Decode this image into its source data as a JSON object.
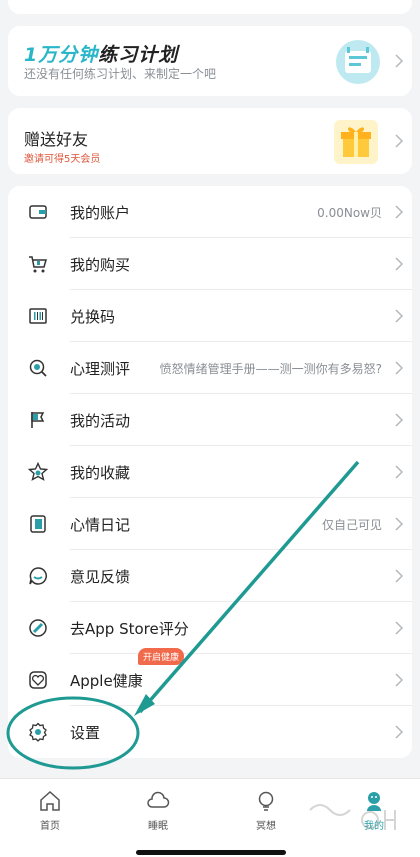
{
  "plan": {
    "title_highlight": "1万分钟",
    "title_rest": "练习计划",
    "subtitle": "还没有任何练习计划、来制定一个吧"
  },
  "gift": {
    "title": "赠送好友",
    "subtitle": "邀请可得5天会员"
  },
  "menu": [
    {
      "label": "我的账户",
      "right": "0.00Now贝",
      "icon": "wallet-icon"
    },
    {
      "label": "我的购买",
      "right": "",
      "icon": "cart-icon"
    },
    {
      "label": "兑换码",
      "right": "",
      "icon": "barcode-icon"
    },
    {
      "label": "心理测评",
      "right": "愤怒情绪管理手册——测一测你有多易怒?",
      "icon": "magnifier-icon"
    },
    {
      "label": "我的活动",
      "right": "",
      "icon": "flag-icon"
    },
    {
      "label": "我的收藏",
      "right": "",
      "icon": "star-icon"
    },
    {
      "label": "心情日记",
      "right": "仅自己可见",
      "icon": "diary-icon"
    },
    {
      "label": "意见反馈",
      "right": "",
      "icon": "chat-icon"
    },
    {
      "label": "去App Store评分",
      "right": "",
      "icon": "app-store-icon"
    },
    {
      "label": "Apple健康",
      "right": "",
      "icon": "heart-icon",
      "badge": "开启健康"
    },
    {
      "label": "设置",
      "right": "",
      "icon": "gear-icon"
    }
  ],
  "tabs": [
    {
      "label": "首页",
      "icon": "home-icon"
    },
    {
      "label": "睡眠",
      "icon": "cloud-icon"
    },
    {
      "label": "冥想",
      "icon": "bulb-icon"
    },
    {
      "label": "我的",
      "icon": "profile-icon",
      "active": true
    }
  ],
  "colors": {
    "accent": "#29b6c9",
    "annotation": "#1f9a93",
    "badge": "#f16a4b"
  }
}
